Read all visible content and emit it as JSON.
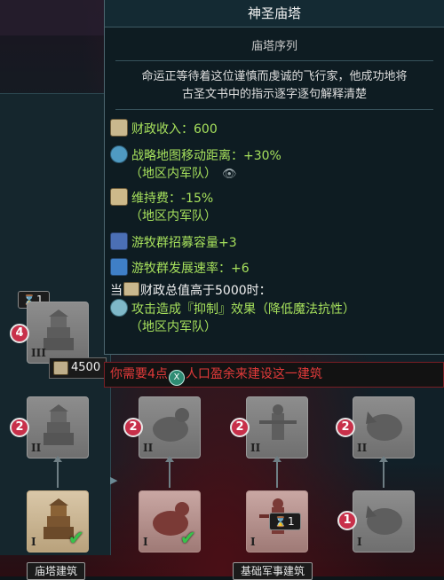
{
  "tooltip": {
    "title": "神圣庙塔",
    "subtitle": "庙塔序列",
    "description_line1": "命运正等待着这位谨慎而虔诚的飞行家，他成功地将",
    "description_line2": "古圣文书中的指示逐字逐句解释清楚",
    "effects": [
      {
        "icon": "gold-coins-icon",
        "text": "财政收入：600",
        "sub": ""
      },
      {
        "icon": "globe-icon",
        "text": "战略地图移动距离：+30%",
        "sub": "（地区内军队）"
      },
      {
        "icon": "scroll-icon",
        "text": "维持费：-15%",
        "sub": "（地区内军队）"
      },
      {
        "icon": "horn-icon",
        "text": "游牧群招募容量+3",
        "sub": ""
      },
      {
        "icon": "flask-icon",
        "text": "游牧群发展速率：+6",
        "sub": ""
      }
    ],
    "condition_prefix": "当",
    "condition_text": "财政总值高于5000时：",
    "condition_effect": {
      "icon": "shield-icon",
      "text": "攻击造成『抑制』效果（降低魔法抗性）",
      "sub": "（地区内军队）"
    }
  },
  "warning": {
    "before": "你需要4点",
    "icon_letter": "X",
    "after": "人口盈余来建设这一建筑"
  },
  "tree": {
    "cost": "4500",
    "turns_top": "1",
    "turns_bottom": "1",
    "tiers": {
      "t1": "I",
      "t2": "II",
      "t3": "III"
    },
    "requirement_numbers": {
      "tier3": "4",
      "tier2": "2",
      "tier1_last": "1"
    },
    "labels": {
      "temple": "庙塔建筑",
      "military": "基础军事建筑"
    }
  },
  "colors": {
    "effect_green": "#a6e05c",
    "warning_red": "#e23a3a",
    "requirement_badge": "#c8304a",
    "built_check": "#38c24a"
  }
}
